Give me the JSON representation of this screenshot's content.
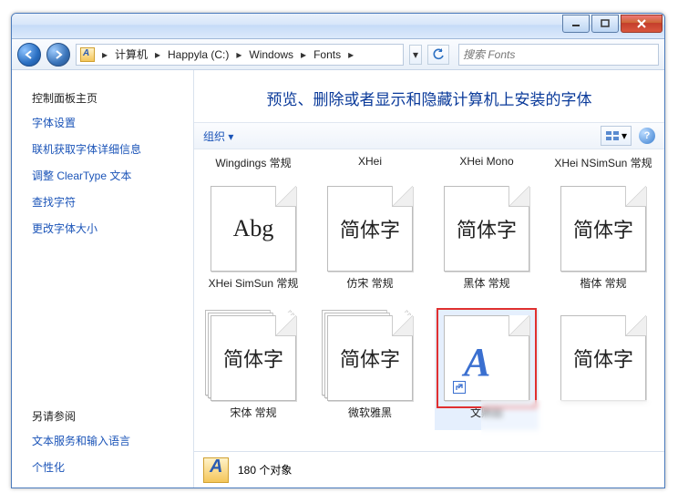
{
  "window": {
    "breadcrumb": [
      "计算机",
      "Happyla (C:)",
      "Windows",
      "Fonts"
    ],
    "search_placeholder": "搜索 Fonts"
  },
  "sidebar": {
    "header": "控制面板主页",
    "links": [
      "字体设置",
      "联机获取字体详细信息",
      "调整 ClearType 文本",
      "查找字符",
      "更改字体大小"
    ],
    "seealso_header": "另请参阅",
    "seealso": [
      "文本服务和输入语言",
      "个性化"
    ]
  },
  "content": {
    "title": "预览、删除或者显示和隐藏计算机上安装的字体",
    "organize": "组织",
    "items": [
      {
        "label_top": "Wingdings 常规",
        "preview": "Abg",
        "style": "abg",
        "label_bottom": "XHei SimSun 常规",
        "stack": false
      },
      {
        "label_top": "XHei",
        "preview": "简体字",
        "style": "cn",
        "label_bottom": "仿宋 常规",
        "stack": false
      },
      {
        "label_top": "XHei Mono",
        "preview": "简体字",
        "style": "cn",
        "label_bottom": "黑体 常规",
        "stack": false
      },
      {
        "label_top": "XHei NSimSun 常规",
        "preview": "简体字",
        "style": "cn",
        "label_bottom": "楷体 常规",
        "stack": false
      }
    ],
    "items2": [
      {
        "preview": "简体字",
        "style": "cn",
        "label_bottom": "宋体 常规",
        "stack": true
      },
      {
        "preview": "简体字",
        "style": "cn",
        "label_bottom": "微软雅黑",
        "stack": true
      },
      {
        "preview": "",
        "style": "aicon",
        "label_bottom": "文鼎超",
        "stack": false,
        "selected": true,
        "shortcut": true
      },
      {
        "preview": "简体字",
        "style": "cn",
        "label_bottom": "",
        "stack": false
      }
    ]
  },
  "status": {
    "count": "180 个对象"
  }
}
